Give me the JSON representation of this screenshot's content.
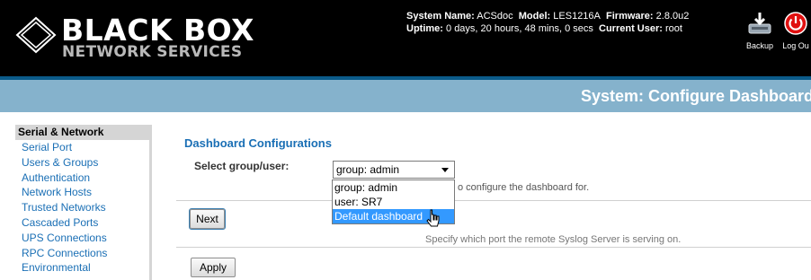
{
  "header": {
    "brand": "BLACK BOX",
    "tagline": "NETWORK SERVICES",
    "system_name_label": "System Name:",
    "system_name": "ACSdoc",
    "model_label": "Model:",
    "model": "LES1216A",
    "firmware_label": "Firmware:",
    "firmware": "2.8.0u2",
    "uptime_label": "Uptime:",
    "uptime": "0 days, 20 hours, 48 mins, 0 secs",
    "current_user_label": "Current User:",
    "current_user": "root",
    "backup_label": "Backup",
    "logout_label": "Log Ou"
  },
  "page_title": "System: Configure Dashboard",
  "sidebar": {
    "section": "Serial & Network",
    "items": [
      {
        "label": "Serial Port"
      },
      {
        "label": "Users & Groups"
      },
      {
        "label": "Authentication"
      },
      {
        "label": "Network Hosts"
      },
      {
        "label": "Trusted Networks"
      },
      {
        "label": "Cascaded Ports"
      },
      {
        "label": "UPS Connections"
      },
      {
        "label": "RPC Connections"
      },
      {
        "label": "Environmental"
      }
    ]
  },
  "main": {
    "section_title": "Dashboard Configurations",
    "select_label": "Select group/user:",
    "select_value": "group: admin",
    "help_text": "o configure the dashboard for.",
    "next_label": "Next",
    "ghost_text": "Specify which port the remote Syslog Server is serving on.",
    "apply_label": "Apply"
  },
  "dropdown": {
    "options": [
      {
        "label": "group: admin"
      },
      {
        "label": "user: SR7"
      },
      {
        "label": "Default dashboard"
      }
    ],
    "highlighted": "Default dashboard"
  },
  "colors": {
    "title_bar": "#85b2cc",
    "accent_line": "#0b5b8a",
    "link": "#1a6fb5",
    "highlight": "#3399ff",
    "logout_icon": "#e01010"
  }
}
